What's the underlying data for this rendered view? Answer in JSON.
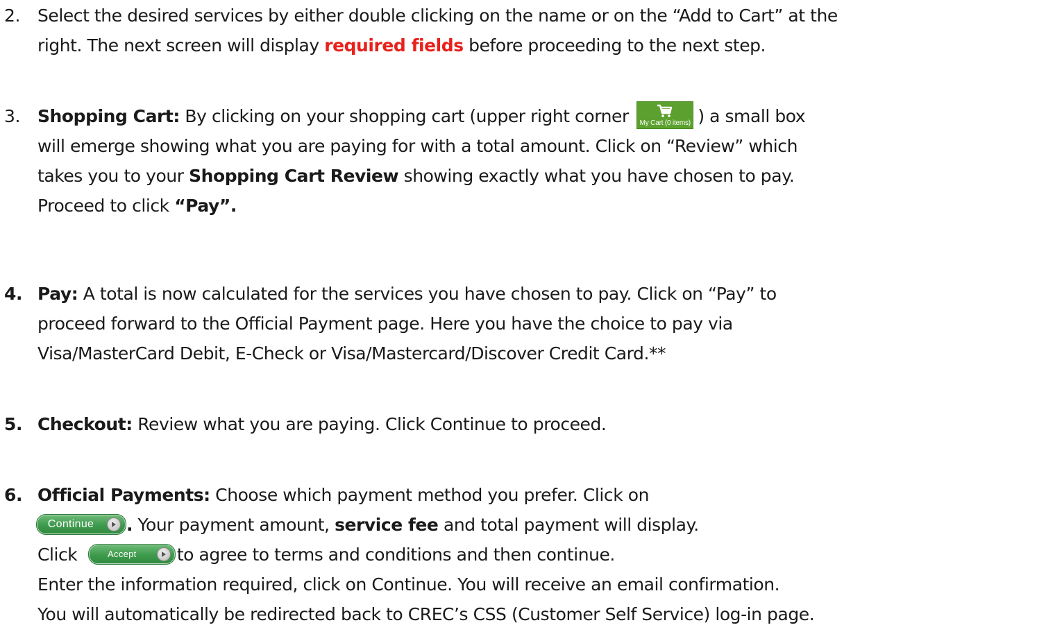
{
  "items": {
    "step2": {
      "number": "2.",
      "line1": "Select the desired services by either double clicking on the name or on the “Add to Cart” at the",
      "line2_pre": "right. The next screen will display ",
      "line2_red": "required fields",
      "line2_post": " before proceeding to the next step."
    },
    "step3": {
      "number": "3.",
      "title": "Shopping Cart:",
      "line1_text": "  By clicking on your shopping cart (upper right corner ",
      "line1_post": ") a small box",
      "cart_badge_label": "My Cart (0 items)",
      "line2": "will emerge showing what you are paying for with a total amount.  Click on “Review” which",
      "line3_pre": "takes you to your ",
      "line3_bold": "Shopping Cart Review",
      "line3_post": " showing exactly what you have chosen to pay.",
      "line4_pre": "Proceed to click ",
      "line4_bold": "“Pay”."
    },
    "step4": {
      "number": "4.",
      "title": "Pay:",
      "line1": "  A total is now calculated for the services you have chosen to pay.  Click on “Pay” to",
      "line2": "proceed forward to the Official Payment page.  Here you have the choice to pay via",
      "line3": "Visa/MasterCard Debit, E-Check or Visa/Mastercard/Discover Credit Card.**"
    },
    "step5": {
      "number": "5.",
      "title": "Checkout:",
      "line1": "  Review what you are paying. Click Continue to proceed."
    },
    "step6": {
      "number": "6.",
      "title": "Official Payments:",
      "line1": "  Choose which payment method you prefer. Click on",
      "continue_button": "Continue",
      "line2_dot": ".",
      "line2_pre": " Your payment amount, ",
      "line2_bold": "service fee",
      "line2_post": " and total payment will display.",
      "line3_pre": "Click ",
      "accept_button": "Accept",
      "line3_post": "to agree to terms and conditions and then continue.",
      "line4": "Enter the information required, click on Continue. You will receive an email confirmation.",
      "line5": "You will automatically be redirected back to CREC’s CSS (Customer Self Service) log-in page."
    }
  },
  "colors": {
    "text": "#1a1a1a",
    "highlight_red": "#e8211b",
    "cart_green": "#5ca12f",
    "button_green": "#3e9a4c"
  },
  "icons": {
    "cart": "shopping-cart-icon",
    "arrow": "chevron-right-icon"
  }
}
